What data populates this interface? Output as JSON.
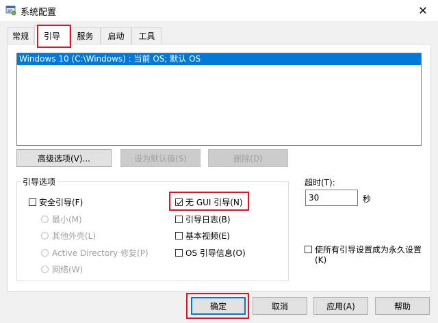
{
  "window": {
    "title": "系统配置",
    "close_glyph": "✕"
  },
  "tabs": [
    {
      "label": "常规"
    },
    {
      "label": "引导"
    },
    {
      "label": "服务"
    },
    {
      "label": "启动"
    },
    {
      "label": "工具"
    }
  ],
  "boot_list": {
    "items": [
      "Windows 10 (C:\\Windows) : 当前 OS; 默认 OS"
    ]
  },
  "entry_buttons": {
    "advanced": "高级选项(V)...",
    "set_default": "设为默认值(S)",
    "delete": "删除(D)"
  },
  "boot_options": {
    "group_label": "引导选项",
    "safe_boot": "安全引导(F)",
    "minimal": "最小(M)",
    "alternate_shell": "其他外壳(L)",
    "active_directory": "Active Directory 修复(P)",
    "network": "网络(W)",
    "no_gui": "无 GUI 引导(N)",
    "boot_log": "引导日志(B)",
    "base_video": "基本视频(E)",
    "os_info": "OS 引导信息(O)"
  },
  "timeout": {
    "label": "超时(T):",
    "value": "30",
    "unit": "秒"
  },
  "permanent": {
    "label_line1": "使所有引导设置成为永久设置",
    "label_line2": "(K)"
  },
  "dialog_buttons": {
    "ok": "确定",
    "cancel": "取消",
    "apply": "应用(A)",
    "help": "帮助"
  },
  "colors": {
    "selection": "#0078d7",
    "highlight": "#e81123"
  },
  "icons": {
    "title": "msconfig-icon",
    "close": "close-icon"
  }
}
